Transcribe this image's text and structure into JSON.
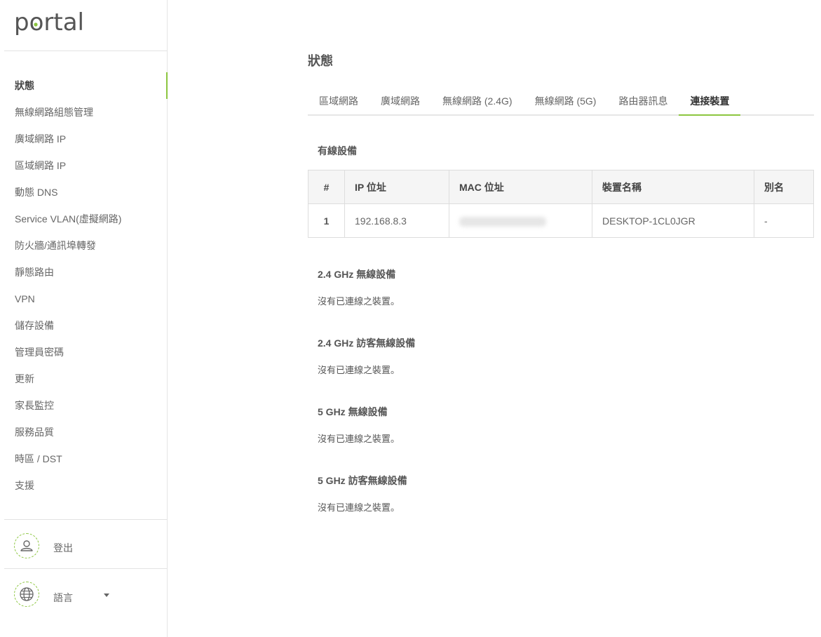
{
  "brand": {
    "logo_text": "portal",
    "accent_color": "#8cc63f"
  },
  "sidebar": {
    "items": [
      {
        "label": "狀態",
        "active": true
      },
      {
        "label": "無線網路組態管理"
      },
      {
        "label": "廣域網路 IP"
      },
      {
        "label": "區域網路 IP"
      },
      {
        "label": "動態 DNS"
      },
      {
        "label": "Service VLAN(虛擬網路)"
      },
      {
        "label": "防火牆/通訊埠轉發"
      },
      {
        "label": "靜態路由"
      },
      {
        "label": "VPN"
      },
      {
        "label": "儲存設備"
      },
      {
        "label": "管理員密碼"
      },
      {
        "label": "更新"
      },
      {
        "label": "家長監控"
      },
      {
        "label": "服務品質"
      },
      {
        "label": "時區 / DST"
      },
      {
        "label": "支援"
      }
    ],
    "logout_label": "登出",
    "language_label": "語言"
  },
  "main": {
    "title": "狀態",
    "tabs": [
      {
        "label": "區域網路"
      },
      {
        "label": "廣域網路"
      },
      {
        "label": "無線網路 (2.4G)"
      },
      {
        "label": "無線網路 (5G)"
      },
      {
        "label": "路由器訊息"
      },
      {
        "label": "連接裝置",
        "active": true
      }
    ],
    "wired": {
      "title": "有線設備",
      "columns": [
        "#",
        "IP 位址",
        "MAC 位址",
        "裝置名稱",
        "別名"
      ],
      "rows": [
        {
          "num": "1",
          "ip": "192.168.8.3",
          "mac": "",
          "name": "DESKTOP-1CL0JGR",
          "alias": "-"
        }
      ]
    },
    "sections": [
      {
        "title": "2.4 GHz 無線設備",
        "empty": "沒有已連線之裝置。"
      },
      {
        "title": "2.4 GHz 訪客無線設備",
        "empty": "沒有已連線之裝置。"
      },
      {
        "title": "5 GHz 無線設備",
        "empty": "沒有已連線之裝置。"
      },
      {
        "title": "5 GHz 訪客無線設備",
        "empty": "沒有已連線之裝置。"
      }
    ]
  }
}
